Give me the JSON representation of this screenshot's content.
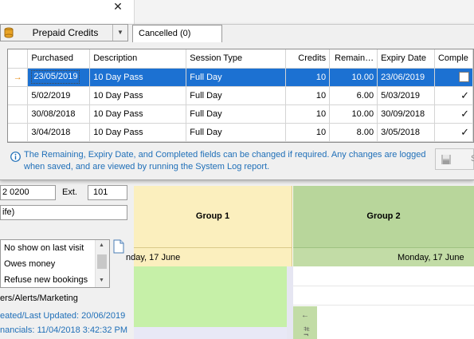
{
  "popup": {
    "mode_combo": {
      "label": "Prepaid Credits"
    },
    "tab_cancelled": "Cancelled (0)",
    "columns": [
      "Purchased",
      "Description",
      "Session Type",
      "Credits",
      "Remain…",
      "Expiry Date",
      "Comple"
    ],
    "rows": [
      {
        "purchased": "23/05/2019",
        "description": "10 Day Pass",
        "session_type": "Full Day",
        "credits": "10",
        "remaining": "10.00",
        "expiry": "23/06/2019",
        "completed": false,
        "selected": true
      },
      {
        "purchased": "5/02/2019",
        "description": "10 Day Pass",
        "session_type": "Full Day",
        "credits": "10",
        "remaining": "6.00",
        "expiry": "5/03/2019",
        "completed": true,
        "selected": false
      },
      {
        "purchased": "30/08/2018",
        "description": "10 Day Pass",
        "session_type": "Full Day",
        "credits": "10",
        "remaining": "10.00",
        "expiry": "30/09/2018",
        "completed": true,
        "selected": false
      },
      {
        "purchased": "3/04/2018",
        "description": "10 Day Pass",
        "session_type": "Full Day",
        "credits": "10",
        "remaining": "8.00",
        "expiry": "3/05/2018",
        "completed": true,
        "selected": false
      }
    ],
    "info_text": "The Remaining, Expiry Date, and Completed fields can be changed if required.  Any changes are logged when saved, and are viewed by running the System Log report.",
    "save_label": "S"
  },
  "close_glyph": "✕",
  "selected_marker": "→",
  "contact": {
    "phone_partial": "2 0200",
    "ext_label": "Ext.",
    "ext_value": "101",
    "relation_partial": "ife)"
  },
  "alerts": {
    "items": [
      "No show on last visit",
      "Owes money",
      "Refuse new bookings"
    ]
  },
  "footer": {
    "categories": "ers/Alerts/Marketing",
    "created_updated": "eated/Last Updated: 20/06/2019",
    "financials": "nancials: 11/04/2018 3:42:32 PM"
  },
  "scheduler": {
    "groups": [
      {
        "name": "Group 1",
        "date": "nday, 17 June",
        "color": "#fbefbe"
      },
      {
        "name": "Group 2",
        "date": "Monday, 17 June",
        "color": "#b8d69b"
      }
    ],
    "side_tab_arrow": "←",
    "side_tab_text": "# r"
  }
}
